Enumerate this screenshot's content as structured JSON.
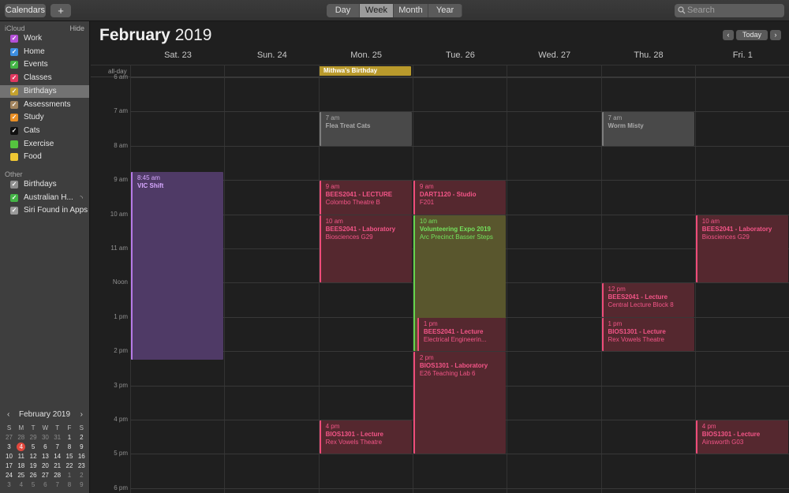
{
  "toolbar": {
    "calendars_label": "Calendars",
    "add_label": "+",
    "views": [
      "Day",
      "Week",
      "Month",
      "Year"
    ],
    "active_view": "Week",
    "search_placeholder": "Search"
  },
  "sidebar": {
    "icloud_header": "iCloud",
    "hide_label": "Hide",
    "icloud_items": [
      {
        "label": "Work",
        "color": "#b34fd6",
        "checked": true
      },
      {
        "label": "Home",
        "color": "#3d8ee0",
        "checked": true
      },
      {
        "label": "Events",
        "color": "#44b446",
        "checked": true
      },
      {
        "label": "Classes",
        "color": "#e0385f",
        "checked": true
      },
      {
        "label": "Birthdays",
        "color": "#c4a22e",
        "checked": true,
        "selected": true
      },
      {
        "label": "Assessments",
        "color": "#a2845e",
        "checked": true
      },
      {
        "label": "Study",
        "color": "#e98f25",
        "checked": true
      },
      {
        "label": "Cats",
        "color": "#111111",
        "checked": true
      },
      {
        "label": "Exercise",
        "color": "#55c43f",
        "checked": false
      },
      {
        "label": "Food",
        "color": "#f0c733",
        "checked": false
      }
    ],
    "other_header": "Other",
    "other_items": [
      {
        "label": "Birthdays",
        "color": "#8e8e8e",
        "checked": true
      },
      {
        "label": "Australian H...",
        "color": "#44b446",
        "checked": true
      },
      {
        "label": "Siri Found in Apps",
        "color": "#9a9a9a",
        "checked": true
      }
    ]
  },
  "minical": {
    "title": "February 2019",
    "weekday_headers": [
      "S",
      "M",
      "T",
      "W",
      "T",
      "F",
      "S"
    ],
    "weeks": [
      [
        "27",
        "28",
        "29",
        "30",
        "31",
        "1",
        "2"
      ],
      [
        "3",
        "4",
        "5",
        "6",
        "7",
        "8",
        "9"
      ],
      [
        "10",
        "11",
        "12",
        "13",
        "14",
        "15",
        "16"
      ],
      [
        "17",
        "18",
        "19",
        "20",
        "21",
        "22",
        "23"
      ],
      [
        "24",
        "25",
        "26",
        "27",
        "28",
        "1",
        "2"
      ],
      [
        "3",
        "4",
        "5",
        "6",
        "7",
        "8",
        "9"
      ]
    ],
    "today": "4"
  },
  "calendar": {
    "month_bold": "February",
    "year": "2019",
    "today_label": "Today",
    "prev_icon": "chevron-left-icon",
    "next_icon": "chevron-right-icon",
    "days": [
      "Sat. 23",
      "Sun. 24",
      "Mon. 25",
      "Tue. 26",
      "Wed. 27",
      "Thu. 28",
      "Fri. 1"
    ],
    "allday_label": "all-day",
    "allday_event": "Mithwa's Birthday",
    "hours": [
      "6 am",
      "7 am",
      "8 am",
      "9 am",
      "10 am",
      "11 am",
      "Noon",
      "1 pm",
      "2 pm",
      "3 pm",
      "4 pm",
      "5 pm",
      "6 pm"
    ],
    "events": [
      {
        "day": 0,
        "start": 8.75,
        "end": 14.25,
        "time": "8:45 am",
        "name": "VIC Shift",
        "location": "",
        "color": "purple"
      },
      {
        "day": 2,
        "start": 7,
        "end": 8,
        "time": "7 am",
        "name": "Flea Treat Cats",
        "location": "",
        "color": "grey"
      },
      {
        "day": 2,
        "start": 9,
        "end": 10,
        "time": "9 am",
        "name": "BEES2041 - LECTURE",
        "location": "Colombo Theatre B",
        "color": "pink"
      },
      {
        "day": 2,
        "start": 10,
        "end": 12,
        "time": "10 am",
        "name": "BEES2041 - Laboratory",
        "location": "Biosciences G29",
        "color": "pink"
      },
      {
        "day": 2,
        "start": 16,
        "end": 17,
        "time": "4 pm",
        "name": "BIOS1301 - Lecture",
        "location": "Rex Vowels Theatre",
        "color": "pink"
      },
      {
        "day": 3,
        "start": 9,
        "end": 10,
        "time": "9 am",
        "name": "DART1120 - Studio",
        "location": "F201",
        "color": "pink"
      },
      {
        "day": 3,
        "start": 10,
        "end": 14,
        "time": "10 am",
        "name": "Volunteering Expo 2019",
        "location": "Arc Precinct Basser Steps",
        "color": "olive"
      },
      {
        "day": 3,
        "start": 13,
        "end": 14,
        "time": "1 pm",
        "name": "BEES2041 - Lecture",
        "location": "Electrical Engineerin...",
        "color": "pink",
        "indent": true
      },
      {
        "day": 3,
        "start": 14,
        "end": 17,
        "time": "2 pm",
        "name": "BIOS1301 - Laboratory",
        "location": "E26 Teaching Lab 6",
        "color": "pink"
      },
      {
        "day": 5,
        "start": 7,
        "end": 8,
        "time": "7 am",
        "name": "Worm Misty",
        "location": "",
        "color": "grey"
      },
      {
        "day": 5,
        "start": 12,
        "end": 13,
        "time": "12 pm",
        "name": "BEES2041 - Lecture",
        "location": "Central Lecture Block 8",
        "color": "pink"
      },
      {
        "day": 5,
        "start": 13,
        "end": 14,
        "time": "1 pm",
        "name": "BIOS1301 - Lecture",
        "location": "Rex Vowels Theatre",
        "color": "pink"
      },
      {
        "day": 6,
        "start": 10,
        "end": 12,
        "time": "10 am",
        "name": "BEES2041 - Laboratory",
        "location": "Biosciences G29",
        "color": "pink"
      },
      {
        "day": 6,
        "start": 16,
        "end": 17,
        "time": "4 pm",
        "name": "BIOS1301 - Lecture",
        "location": "Ainsworth G03",
        "color": "pink"
      }
    ]
  }
}
